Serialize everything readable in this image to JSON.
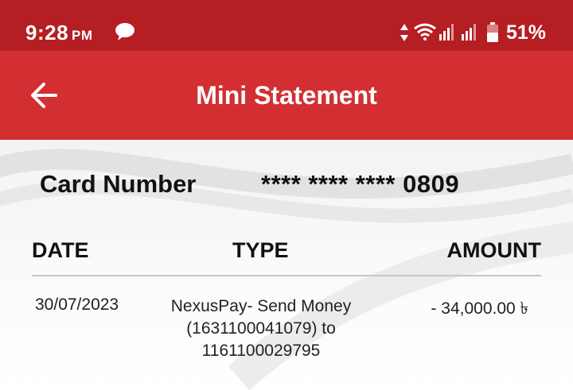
{
  "status_bar": {
    "time": "9:28",
    "ampm": "PM",
    "battery_percent": "51%",
    "icons": [
      "chat-icon",
      "data-arrows-icon",
      "wifi-icon",
      "signal-icon",
      "signal-icon",
      "battery-icon"
    ]
  },
  "app_bar": {
    "title": "Mini Statement",
    "back_icon": "arrow-left-icon",
    "color": "#d32f33"
  },
  "card": {
    "label": "Card Number",
    "value": "**** **** **** 0809"
  },
  "table": {
    "headers": [
      "DATE",
      "TYPE",
      "AMOUNT"
    ],
    "rows": [
      {
        "date": "30/07/2023",
        "type_lines": [
          "NexusPay- Send Money",
          "(1631100041079) to",
          "1161100029795"
        ],
        "amount": "- 34,000.00 ৳"
      }
    ]
  },
  "colors": {
    "status_bar": "#b51e23",
    "app_bar": "#d32f33",
    "text": "#111111"
  }
}
